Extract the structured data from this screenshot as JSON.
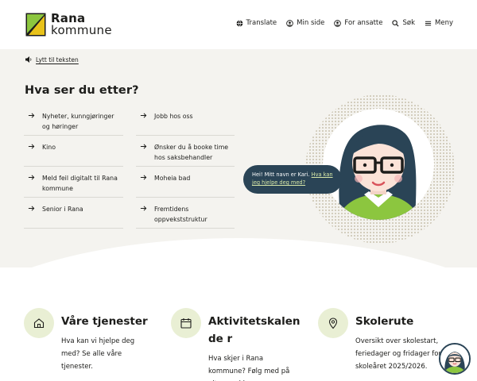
{
  "header": {
    "logo_line1": "Rana",
    "logo_line2": "kommune",
    "nav": [
      {
        "label": "Translate",
        "icon": "globe-icon"
      },
      {
        "label": "Min side",
        "icon": "user-circle-icon"
      },
      {
        "label": "For ansatte",
        "icon": "user-circle-icon"
      },
      {
        "label": "Søk",
        "icon": "search-icon"
      },
      {
        "label": "Meny",
        "icon": "menu-icon"
      }
    ]
  },
  "hero": {
    "listen_label": "Lytt til teksten",
    "title": "Hva ser du etter?",
    "links": [
      {
        "label": "Nyheter, kunngjøringer og høringer"
      },
      {
        "label": "Jobb hos oss"
      },
      {
        "label": "Kino"
      },
      {
        "label": "Ønsker du å booke time hos saksbehandler"
      },
      {
        "label": "Meld feil digitalt til Rana kommune"
      },
      {
        "label": "Moheia bad"
      },
      {
        "label": "Senior i Rana"
      },
      {
        "label": "Fremtidens oppvekststruktur"
      }
    ],
    "bubble_text": "Hei! Mitt navn er Kari. ",
    "bubble_link": "Hva kan jeg hjelpe deg med?"
  },
  "services": [
    {
      "title": "Våre tjenester",
      "text": "Hva kan vi hjelpe deg med? Se alle våre tjenester.",
      "icon": "house-icon"
    },
    {
      "title": "Aktivitetskalende r",
      "text": "Hva skjer i Rana kommune? Følg med på alt som skjer.",
      "icon": "calendar-icon"
    },
    {
      "title": "Skolerute",
      "text": "Oversikt over skolestart, feriedager og fridager for skoleåret 2025/2026.",
      "icon": "location-pin-icon"
    }
  ],
  "colors": {
    "brand_green": "#8cc63f",
    "brand_dark": "#1d1d1b",
    "bubble": "#2a4456",
    "icon_bg": "#e9efd4",
    "hero_bg": "#f4f3ef"
  }
}
